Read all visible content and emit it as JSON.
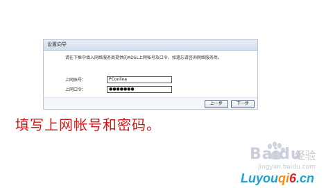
{
  "dialog": {
    "title": "设置向导",
    "description": "请在下框中填入网络服务商提供的ADSL上网帐号及口令，如遗忘请咨询网络服务商。",
    "account_label": "上网账号：",
    "account_value": "PConline",
    "password_label": "上网口令：",
    "password_value": "●●●●●●●",
    "prev_label": "上一步",
    "next_label": "下一步"
  },
  "caption": "填写上网帐号和密码。",
  "watermark": {
    "baidu": "Baidu",
    "jingyan": "经验",
    "url": "jingyan.baidu.com"
  },
  "logo": {
    "part1": "Luyou",
    "part2": "qi",
    "part3": "6",
    "part4": ".cn"
  },
  "colors": {
    "caption": "#d01818",
    "dialog_border": "#b9c6d6",
    "logo_blue": "#1aa3d6",
    "logo_orange": "#f28a1c",
    "logo_red": "#d8232a"
  }
}
